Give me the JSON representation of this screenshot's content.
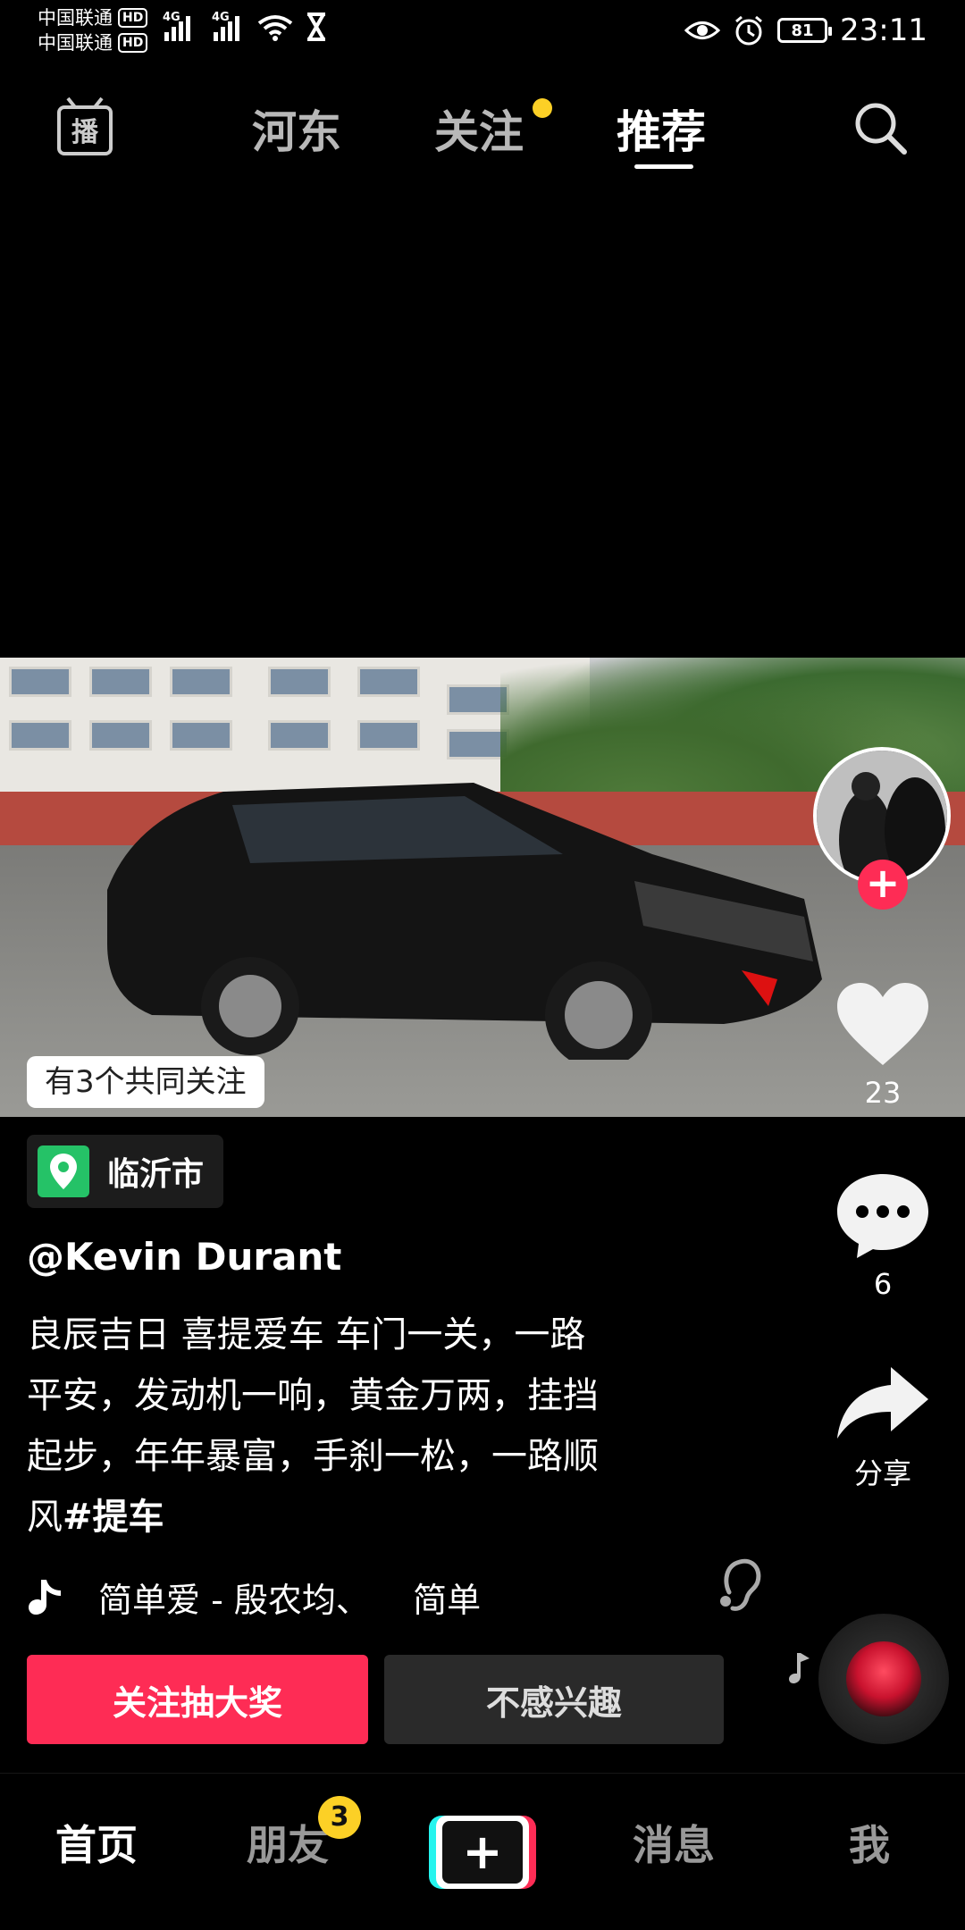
{
  "status_bar": {
    "carrier1": "中国联通",
    "carrier2": "中国联通",
    "hd": "HD",
    "net1": "4G",
    "net2": "4G",
    "battery": "81",
    "time": "23:11"
  },
  "top_nav": {
    "live_label": "直播",
    "tabs": [
      {
        "label": "河东"
      },
      {
        "label": "关注"
      },
      {
        "label": "推荐"
      }
    ],
    "active_tab": "推荐"
  },
  "video": {
    "mutual_follow": "有3个共同关注"
  },
  "actions": {
    "likes": "23",
    "comments": "6",
    "share_label": "分享"
  },
  "post": {
    "location": "临沂市",
    "author": "@Kevin Durant",
    "caption_lines": [
      "良辰吉日 喜提爱车  车门一关，一路",
      "平安，发动机一响，黄金万两，挂挡",
      "起步，年年暴富，手刹一松，一路顺"
    ],
    "caption_last": "风",
    "hashtag": "#提车",
    "music": "简单爱 - 殷农均、    简单"
  },
  "buttons": {
    "follow_draw": "关注抽大奖",
    "not_interested": "不感兴趣"
  },
  "bottom_nav": {
    "home": "首页",
    "friends": "朋友",
    "friends_badge": "3",
    "create": "+",
    "messages": "消息",
    "me": "我"
  },
  "colors": {
    "accent_red": "#fe2c55",
    "badge_yellow": "#fcd026",
    "location_green": "#25c267",
    "cyan": "#25f4ee"
  }
}
